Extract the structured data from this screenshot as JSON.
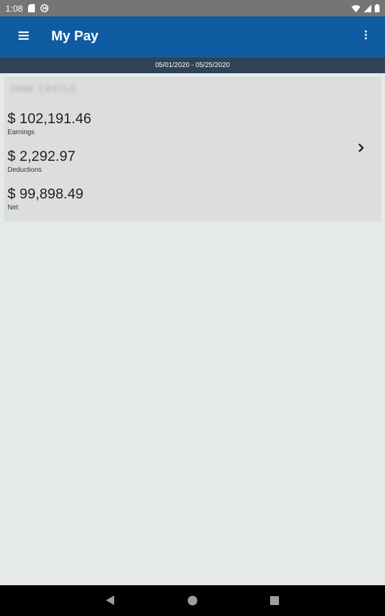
{
  "status_bar": {
    "time": "1:08",
    "icons": [
      "sd-card-icon",
      "sync-icon",
      "wifi-icon",
      "cellular-icon",
      "battery-icon"
    ]
  },
  "app_bar": {
    "title": "My Pay",
    "menu_icon": "hamburger-menu-icon",
    "overflow_icon": "more-vert-icon",
    "background": "#0f5ca3"
  },
  "date_range": {
    "text": "05/01/2020 - 05/25/2020",
    "background": "#2f4256"
  },
  "pay_card": {
    "employee_name": "JANE CASTLE",
    "earnings": {
      "amount": "$ 102,191.46",
      "label": "Earnings"
    },
    "deductions": {
      "amount": "$ 2,292.97",
      "label": "Deductions"
    },
    "net": {
      "amount": "$ 99,898.49",
      "label": "Net"
    },
    "chevron_icon": "chevron-right-icon"
  },
  "nav_bar": {
    "buttons": [
      "back-icon",
      "home-icon",
      "recents-icon"
    ]
  }
}
